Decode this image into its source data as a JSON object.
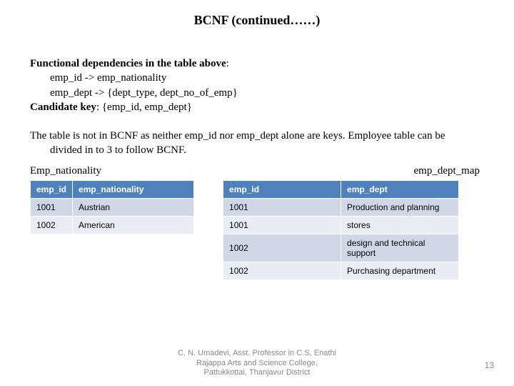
{
  "title": "BCNF (continued……)",
  "fd": {
    "label": "Functional dependencies in the table above",
    "line1": "emp_id -> emp_nationality",
    "line2": "emp_dept -> {dept_type, dept_no_of_emp}"
  },
  "ck": {
    "label": "Candidate key",
    "value": "{emp_id, emp_dept}"
  },
  "paragraph": {
    "line1": "The table is not in BCNF as neither emp_id nor emp_dept alone are keys. Employee table can be",
    "line2": "divided in to 3 to follow BCNF."
  },
  "table1": {
    "caption": "Emp_nationality",
    "h1": "emp_id",
    "h2": "emp_nationality",
    "rows": [
      {
        "c1": "1001",
        "c2": "Austrian"
      },
      {
        "c1": "1002",
        "c2": "American"
      }
    ]
  },
  "table2": {
    "caption": "emp_dept_map",
    "h1": "emp_id",
    "h2": "emp_dept",
    "rows": [
      {
        "c1": "1001",
        "c2": "Production and planning"
      },
      {
        "c1": "1001",
        "c2": "stores"
      },
      {
        "c1": "1002",
        "c2": "design and technical support"
      },
      {
        "c1": "1002",
        "c2": "Purchasing department"
      }
    ]
  },
  "footer": {
    "l1": "C. N. Umadevi, Asst. Professor in C.S, Enathi",
    "l2": "Rajappa Arts and Science College,",
    "l3": "Pattukkottai, Thanjavur District"
  },
  "page": "13"
}
